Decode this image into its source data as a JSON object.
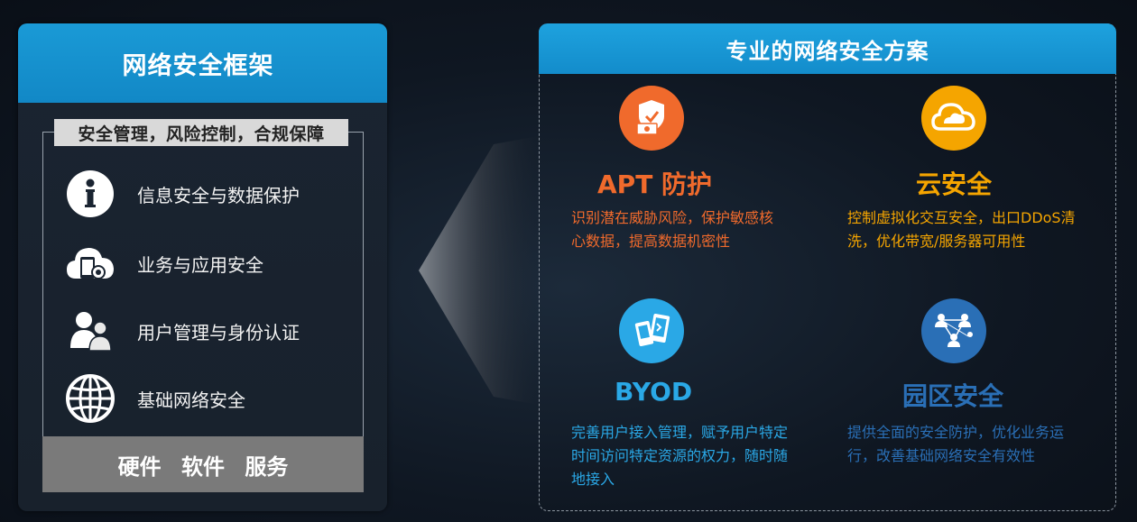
{
  "colors": {
    "blue_header": "#1a9ad6",
    "orange": "#f06a2c",
    "yellow": "#f5a500",
    "sky": "#2aa8e6",
    "navy": "#2a6fb6"
  },
  "left": {
    "title": "网络安全框架",
    "tag": "安全管理，风险控制，合规保障",
    "items": [
      {
        "icon": "info-icon",
        "label": "信息安全与数据保护"
      },
      {
        "icon": "cloud-app-icon",
        "label": "业务与应用安全"
      },
      {
        "icon": "users-icon",
        "label": "用户管理与身份认证"
      },
      {
        "icon": "globe-icon",
        "label": "基础网络安全"
      }
    ],
    "footer": "硬件 软件 服务"
  },
  "right": {
    "title": "专业的网络安全方案",
    "features": [
      {
        "icon": "shield-money-icon",
        "title": "APT 防护",
        "desc_lines": [
          "识别潜在威胁风险，保护敏感核",
          "心数据，提高数据机密性"
        ]
      },
      {
        "icon": "cloud-icon",
        "title": "云安全",
        "desc_lines": [
          "控制虚拟化交互安全，出口DDoS清",
          "洗，优化带宽/服务器可用性"
        ]
      },
      {
        "icon": "mobile-devices-icon",
        "title": "BYOD",
        "desc_lines": [
          "完善用户接入管理，赋予用户特定",
          "时间访问特定资源的权力，随时随",
          "地接入"
        ]
      },
      {
        "icon": "network-people-icon",
        "title": "园区安全",
        "desc_lines": [
          "提供全面的安全防护，优化业务运",
          "行，改善基础网络安全有效性"
        ]
      }
    ]
  }
}
